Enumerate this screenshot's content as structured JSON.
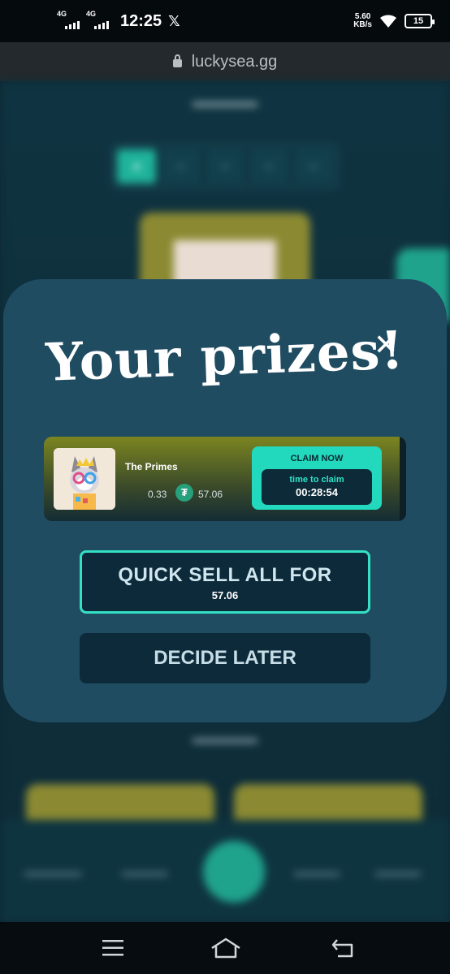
{
  "status_bar": {
    "signal1_label": "4G",
    "signal2_label": "4G",
    "time": "12:25",
    "notif_icon": "x-logo",
    "net_speed_value": "5.60",
    "net_speed_unit": "KB/s",
    "battery": "15"
  },
  "browser": {
    "url": "luckysea.gg"
  },
  "modal": {
    "title": "Your prizes!",
    "close_icon": "close-icon",
    "prize": {
      "name": "The Primes",
      "amount": "0.33",
      "currency_icon": "tether-icon",
      "price": "57.06",
      "claim_label": "CLAIM NOW",
      "time_label": "time to claim",
      "countdown": "00:28:54"
    },
    "quick_sell_label": "QUICK SELL ALL FOR",
    "quick_sell_value": "57.06",
    "decide_later_label": "DECIDE LATER"
  },
  "colors": {
    "accent": "#22d8bd",
    "modal_bg": "#204c62",
    "button_bg": "#0d2a3a"
  }
}
